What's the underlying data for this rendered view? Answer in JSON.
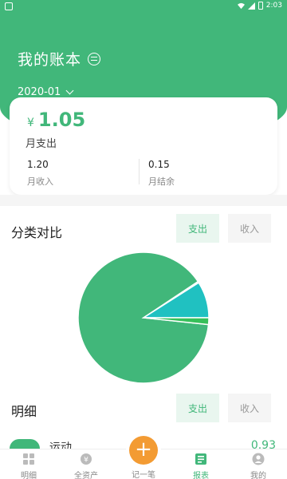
{
  "status_bar": {
    "time": "2:03"
  },
  "header": {
    "title": "我的账本",
    "month": "2020-01"
  },
  "summary": {
    "currency": "¥",
    "expense_amount": "1.05",
    "expense_label": "月支出",
    "income_amount": "1.20",
    "income_label": "月收入",
    "balance_amount": "0.15",
    "balance_label": "月结余"
  },
  "category_section": {
    "title": "分类对比",
    "tab_expense": "支出",
    "tab_income": "收入",
    "active_tab": "支出"
  },
  "detail_section": {
    "title": "明细",
    "tab_expense": "支出",
    "tab_income": "收入",
    "active_tab": "支出"
  },
  "chart_data": {
    "type": "pie",
    "title": "",
    "slices": [
      {
        "value": 0.89,
        "color": "#41b77a"
      },
      {
        "value": 0.09,
        "color": "#20c1c1"
      },
      {
        "value": 0.02,
        "color": "#37c05a"
      }
    ]
  },
  "detail_row": {
    "label": "运动",
    "amount": "0.93"
  },
  "bottom_nav": {
    "items": [
      {
        "label": "明细",
        "icon": "grid-icon"
      },
      {
        "label": "全资产",
        "icon": "asset-icon"
      },
      {
        "label": "记一笔",
        "icon": "plus-icon"
      },
      {
        "label": "报表",
        "icon": "report-icon"
      },
      {
        "label": "我的",
        "icon": "profile-icon"
      }
    ],
    "active": "报表"
  },
  "colors": {
    "primary": "#41b77a",
    "accent": "#f39b33",
    "teal": "#20c1c1"
  }
}
